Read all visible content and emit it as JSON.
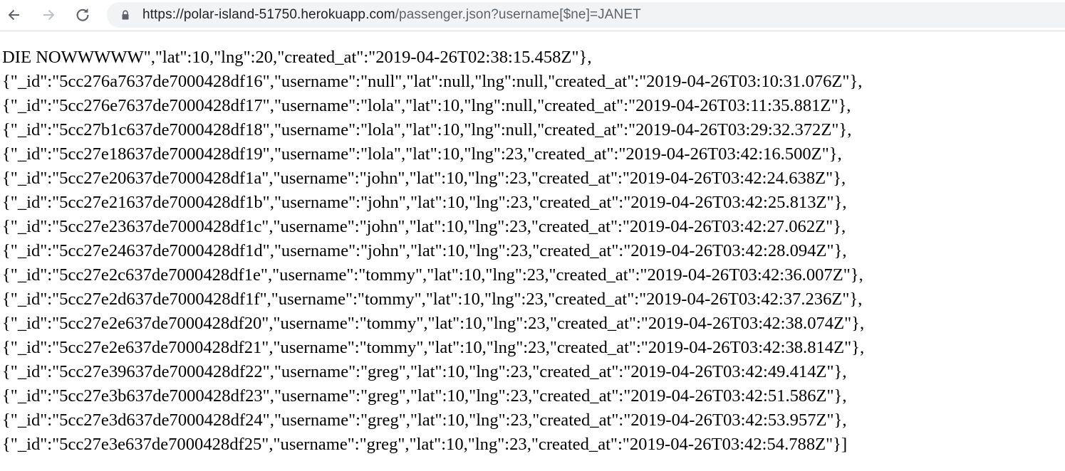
{
  "browser": {
    "url_host": "https://polar-island-51750.herokuapp.com",
    "url_path": "/passenger.json?username[$ne]=JANET",
    "back_icon": "back-arrow-icon",
    "forward_icon": "forward-arrow-icon",
    "reload_icon": "reload-icon",
    "lock_icon": "lock-icon"
  },
  "json_lines": [
    "DIE NOWWWWW\",\"lat\":10,\"lng\":20,\"created_at\":\"2019-04-26T02:38:15.458Z\"},",
    "{\"_id\":\"5cc276a7637de7000428df16\",\"username\":\"null\",\"lat\":null,\"lng\":null,\"created_at\":\"2019-04-26T03:10:31.076Z\"},",
    "{\"_id\":\"5cc276e7637de7000428df17\",\"username\":\"lola\",\"lat\":10,\"lng\":null,\"created_at\":\"2019-04-26T03:11:35.881Z\"},",
    "{\"_id\":\"5cc27b1c637de7000428df18\",\"username\":\"lola\",\"lat\":10,\"lng\":null,\"created_at\":\"2019-04-26T03:29:32.372Z\"},",
    "{\"_id\":\"5cc27e18637de7000428df19\",\"username\":\"lola\",\"lat\":10,\"lng\":23,\"created_at\":\"2019-04-26T03:42:16.500Z\"},",
    "{\"_id\":\"5cc27e20637de7000428df1a\",\"username\":\"john\",\"lat\":10,\"lng\":23,\"created_at\":\"2019-04-26T03:42:24.638Z\"},",
    "{\"_id\":\"5cc27e21637de7000428df1b\",\"username\":\"john\",\"lat\":10,\"lng\":23,\"created_at\":\"2019-04-26T03:42:25.813Z\"},",
    "{\"_id\":\"5cc27e23637de7000428df1c\",\"username\":\"john\",\"lat\":10,\"lng\":23,\"created_at\":\"2019-04-26T03:42:27.062Z\"},",
    "{\"_id\":\"5cc27e24637de7000428df1d\",\"username\":\"john\",\"lat\":10,\"lng\":23,\"created_at\":\"2019-04-26T03:42:28.094Z\"},",
    "{\"_id\":\"5cc27e2c637de7000428df1e\",\"username\":\"tommy\",\"lat\":10,\"lng\":23,\"created_at\":\"2019-04-26T03:42:36.007Z\"},",
    "{\"_id\":\"5cc27e2d637de7000428df1f\",\"username\":\"tommy\",\"lat\":10,\"lng\":23,\"created_at\":\"2019-04-26T03:42:37.236Z\"},",
    "{\"_id\":\"5cc27e2e637de7000428df20\",\"username\":\"tommy\",\"lat\":10,\"lng\":23,\"created_at\":\"2019-04-26T03:42:38.074Z\"},",
    "{\"_id\":\"5cc27e2e637de7000428df21\",\"username\":\"tommy\",\"lat\":10,\"lng\":23,\"created_at\":\"2019-04-26T03:42:38.814Z\"},",
    "{\"_id\":\"5cc27e39637de7000428df22\",\"username\":\"greg\",\"lat\":10,\"lng\":23,\"created_at\":\"2019-04-26T03:42:49.414Z\"},",
    "{\"_id\":\"5cc27e3b637de7000428df23\",\"username\":\"greg\",\"lat\":10,\"lng\":23,\"created_at\":\"2019-04-26T03:42:51.586Z\"},",
    "{\"_id\":\"5cc27e3d637de7000428df24\",\"username\":\"greg\",\"lat\":10,\"lng\":23,\"created_at\":\"2019-04-26T03:42:53.957Z\"},",
    "{\"_id\":\"5cc27e3e637de7000428df25\",\"username\":\"greg\",\"lat\":10,\"lng\":23,\"created_at\":\"2019-04-26T03:42:54.788Z\"}]"
  ]
}
